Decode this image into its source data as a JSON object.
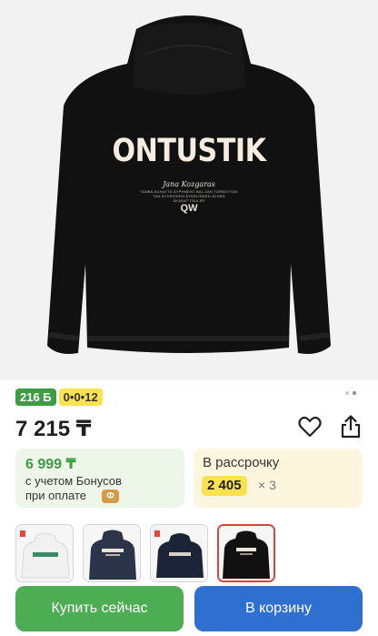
{
  "product": {
    "image": {
      "alt": "hoodie-back-print",
      "print_title": "ONTUSTIK",
      "print_script": "Jana Kozgaras",
      "print_fine": [
        "TANBÁ AUHAYTE ÁYPHMENT BAL ZAN TORBOYTAN",
        "TAN ÁYDERÍDEN ÁYDELÍNDEN ÁZHEN",
        "ÁKARAT TÁULER"
      ],
      "print_logo": "QW",
      "carousel_dots": 2,
      "active_dot": 1
    },
    "badges": {
      "bonus": "216 Б",
      "installment": "0•0•12"
    },
    "price": "7 215 ₸",
    "actions": {
      "favorite_icon": "heart-outline-icon",
      "share_icon": "share-icon"
    },
    "bonus_card": {
      "price": "6 999 ₸",
      "line1": "с учетом Бонусов",
      "line2": "при оплате",
      "chip": "Ф"
    },
    "installment_card": {
      "title": "В рассрочку",
      "amount": "2 405",
      "times": "× 3"
    },
    "variants": [
      {
        "label": "white-hoodie",
        "color": "#f3f3f3"
      },
      {
        "label": "navy-hoodie-ontustik",
        "color": "#2b3448"
      },
      {
        "label": "navy-hoodie-front",
        "color": "#1c2438"
      },
      {
        "label": "black-hoodie",
        "color": "#111111",
        "selected": true
      }
    ],
    "buttons": {
      "buy_now": "Купить сейчас",
      "add_to_cart": "В корзину"
    },
    "colors": {
      "green": "#4cad53",
      "blue": "#2f6fd0",
      "yellow": "#fde24f",
      "selected_border": "#d9443c"
    }
  }
}
